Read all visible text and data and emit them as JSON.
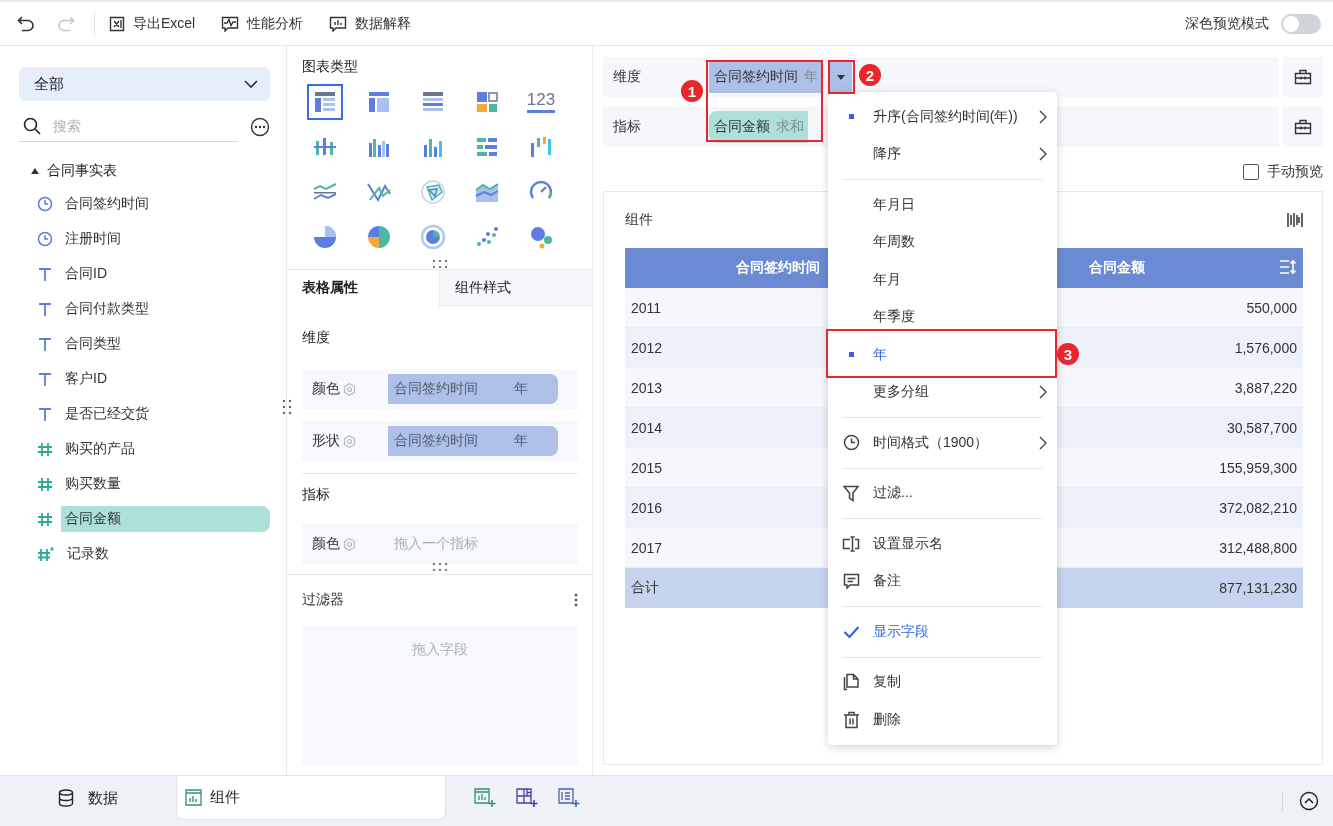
{
  "toolbar": {
    "undo": {
      "disabled": false
    },
    "redo": {
      "disabled": true
    },
    "actions": [
      {
        "label": "导出Excel"
      },
      {
        "label": "性能分析"
      },
      {
        "label": "数据解释"
      }
    ],
    "dark_mode": {
      "label": "深色预览模式",
      "on": false
    }
  },
  "fields_panel": {
    "scope": "全部",
    "search": {
      "placeholder": "搜索"
    },
    "tree": [
      {
        "label": "合同事实表",
        "expanded": true,
        "children": [
          {
            "label": "合同签约时间",
            "kind": "time",
            "selected": false
          },
          {
            "label": "注册时间",
            "kind": "time",
            "selected": false
          },
          {
            "label": "合同ID",
            "kind": "text",
            "selected": false
          },
          {
            "label": "合同付款类型",
            "kind": "text",
            "selected": false
          },
          {
            "label": "合同类型",
            "kind": "text",
            "selected": false
          },
          {
            "label": "客户ID",
            "kind": "text",
            "selected": false
          },
          {
            "label": "是否已经交货",
            "kind": "text",
            "selected": false
          },
          {
            "label": "购买的产品",
            "kind": "number",
            "selected": false
          },
          {
            "label": "购买数量",
            "kind": "number",
            "selected": false
          },
          {
            "label": "合同金额",
            "kind": "number",
            "selected": true
          },
          {
            "label": "记录数",
            "kind": "count",
            "selected": false
          }
        ]
      }
    ]
  },
  "chart_panel": {
    "title": "图表类型",
    "chart_types": [
      {
        "selected": true
      },
      {
        "selected": false
      },
      {
        "selected": false
      },
      {
        "selected": false
      },
      {
        "selected": false,
        "label": "123"
      },
      {
        "selected": false
      },
      {
        "selected": false
      },
      {
        "selected": false
      },
      {
        "selected": false
      },
      {
        "selected": false
      },
      {
        "selected": false
      },
      {
        "selected": false
      },
      {
        "selected": false
      },
      {
        "selected": false
      },
      {
        "selected": false
      },
      {
        "selected": false
      },
      {
        "selected": false
      },
      {
        "selected": false
      },
      {
        "selected": false
      },
      {
        "selected": false
      }
    ],
    "tabs": [
      {
        "label": "表格属性",
        "selected": true
      },
      {
        "label": "组件样式",
        "selected": false
      }
    ],
    "sections": [
      {
        "title": "维度",
        "rows": [
          {
            "label": "颜色",
            "field": "合同签约时间",
            "suffix": "年"
          },
          {
            "label": "形状",
            "field": "合同签约时间",
            "suffix": "年"
          }
        ]
      },
      {
        "title": "指标",
        "rows": [
          {
            "label": "颜色",
            "placeholder": "拖入一个指标"
          }
        ]
      }
    ],
    "filter": {
      "title": "过滤器",
      "placeholder": "拖入字段"
    }
  },
  "editor": {
    "shelves": [
      {
        "label": "维度",
        "chip": {
          "field": "合同签约时间",
          "suffix": "年",
          "kind": "dimension"
        }
      },
      {
        "label": "指标",
        "chip": {
          "field": "合同金额",
          "suffix": "求和",
          "kind": "measure"
        }
      }
    ],
    "manual_preview": {
      "label": "手动预览",
      "checked": false
    },
    "widget": {
      "title": "组件",
      "table": {
        "columns": [
          "合同签约时间",
          "合同金额"
        ],
        "rows": [
          [
            "2011",
            "550,000"
          ],
          [
            "2012",
            "1,576,000"
          ],
          [
            "2013",
            "3,887,220"
          ],
          [
            "2014",
            "30,587,700"
          ],
          [
            "2015",
            "155,959,300"
          ],
          [
            "2016",
            "372,082,210"
          ],
          [
            "2017",
            "312,488,800"
          ]
        ],
        "total": [
          "合计",
          "877,131,230"
        ]
      }
    }
  },
  "menu": {
    "sections": [
      [
        {
          "label": "升序(合同签约时间(年))",
          "kind": "sort",
          "selected": true,
          "submenu": true
        },
        {
          "label": "降序",
          "kind": "sort",
          "selected": false,
          "submenu": true
        }
      ],
      [
        {
          "label": "年月日",
          "kind": "group",
          "selected": false,
          "submenu": false
        },
        {
          "label": "年周数",
          "kind": "group",
          "selected": false,
          "submenu": false
        },
        {
          "label": "年月",
          "kind": "group",
          "selected": false,
          "submenu": false
        },
        {
          "label": "年季度",
          "kind": "group",
          "selected": false,
          "submenu": false
        },
        {
          "label": "年",
          "kind": "group",
          "selected": true,
          "submenu": false
        },
        {
          "label": "更多分组",
          "kind": "group",
          "selected": false,
          "submenu": true
        }
      ],
      [
        {
          "label": "时间格式（1900）",
          "kind": "time-format",
          "submenu": true
        }
      ],
      [
        {
          "label": "过滤...",
          "kind": "filter",
          "submenu": false
        }
      ],
      [
        {
          "label": "设置显示名",
          "kind": "rename",
          "submenu": false
        },
        {
          "label": "备注",
          "kind": "note",
          "submenu": false
        }
      ],
      [
        {
          "label": "显示字段",
          "kind": "toggle",
          "checked": true,
          "submenu": false
        }
      ],
      [
        {
          "label": "复制",
          "kind": "copy",
          "submenu": false
        },
        {
          "label": "删除",
          "kind": "delete",
          "submenu": false
        }
      ]
    ]
  },
  "bottom_bar": {
    "tabs": [
      {
        "label": "数据",
        "selected": false
      },
      {
        "label": "组件",
        "selected": true
      }
    ]
  },
  "annotations": [
    {
      "label": "1"
    },
    {
      "label": "2"
    },
    {
      "label": "3"
    }
  ]
}
